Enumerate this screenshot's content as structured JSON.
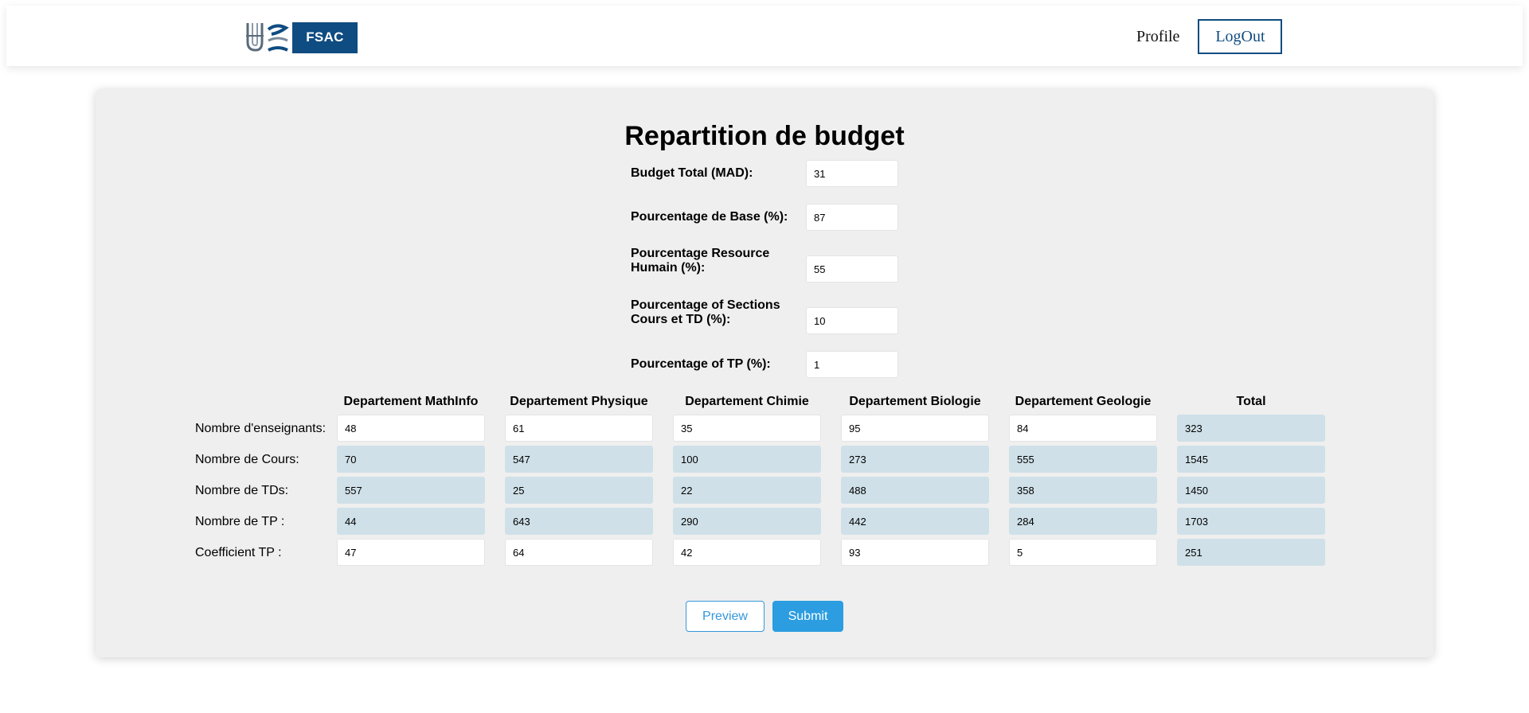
{
  "header": {
    "logo_text": "FSAC",
    "nav": {
      "profile_label": "Profile",
      "logout_label": "LogOut"
    },
    "colors": {
      "brand": "#0f4c81"
    }
  },
  "form": {
    "title": "Repartition de budget",
    "params": [
      {
        "label": "Budget Total (MAD):",
        "value": "31"
      },
      {
        "label": "Pourcentage de Base (%):",
        "value": "87"
      },
      {
        "label": "Pourcentage Resource Humain (%):",
        "value": "55"
      },
      {
        "label": "Pourcentage of Sections Cours et TD (%):",
        "value": "10"
      },
      {
        "label": "Pourcentage of TP (%):",
        "value": "1"
      }
    ]
  },
  "table": {
    "columns": [
      "Departement MathInfo",
      "Departement Physique",
      "Departement Chimie",
      "Departement Biologie",
      "Departement Geologie",
      "Total"
    ],
    "rows": [
      {
        "label": "Nombre d'enseignants:",
        "values": [
          "48",
          "61",
          "35",
          "95",
          "84",
          "323"
        ]
      },
      {
        "label": "Nombre de Cours:",
        "values": [
          "70",
          "547",
          "100",
          "273",
          "555",
          "1545"
        ]
      },
      {
        "label": "Nombre de TDs:",
        "values": [
          "557",
          "25",
          "22",
          "488",
          "358",
          "1450"
        ]
      },
      {
        "label": "Nombre de TP :",
        "values": [
          "44",
          "643",
          "290",
          "442",
          "284",
          "1703"
        ]
      },
      {
        "label": "Coefficient TP :",
        "values": [
          "47",
          "64",
          "42",
          "93",
          "5",
          "251"
        ]
      }
    ]
  },
  "actions": {
    "preview_label": "Preview",
    "submit_label": "Submit"
  },
  "colors": {
    "readonly_cell": "#cfe0e8",
    "accent": "#2b9de0",
    "card_bg": "#efefef"
  }
}
